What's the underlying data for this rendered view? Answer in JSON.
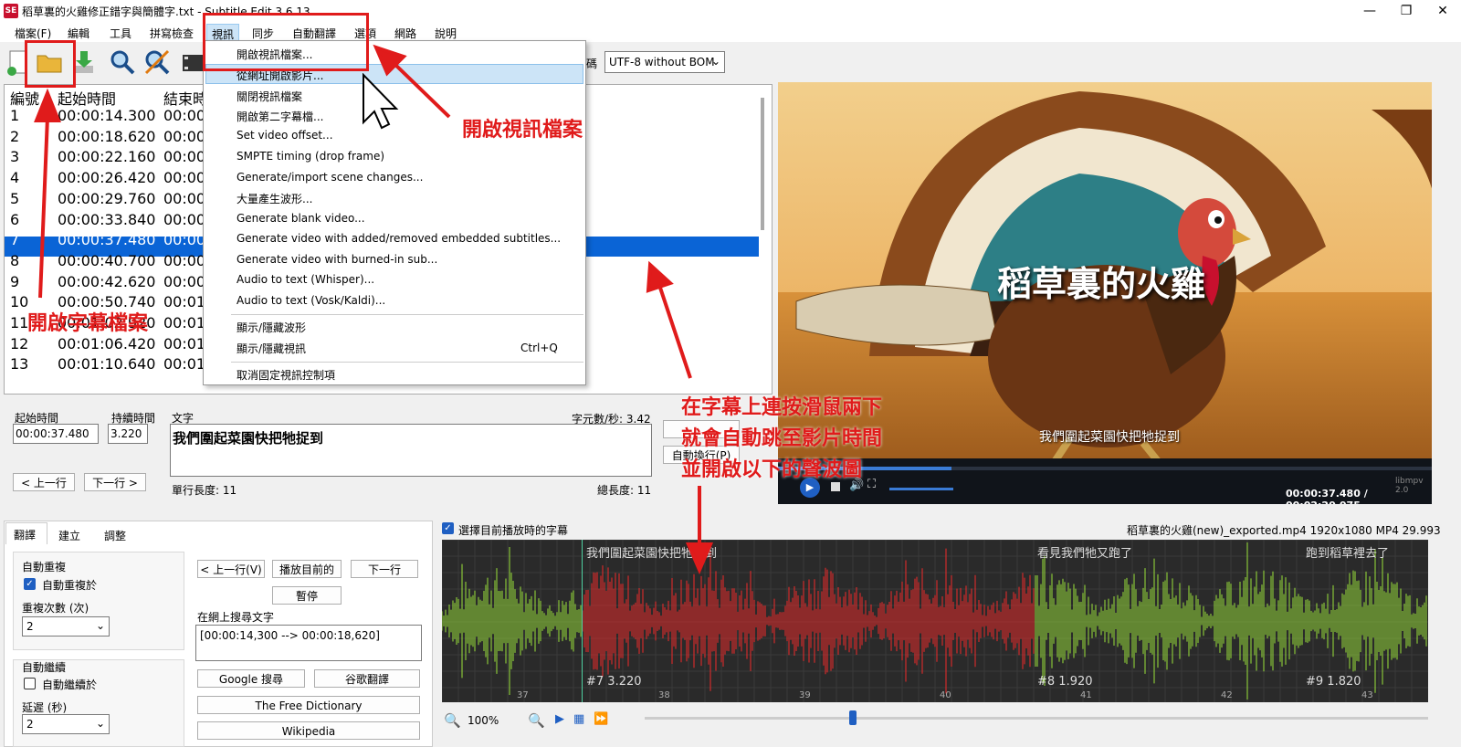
{
  "window": {
    "title": "稻草裏的火雞修正錯字與簡體字.txt - Subtitle Edit 3.6.13",
    "app_icon": "SE",
    "controls": [
      "—",
      "❐",
      "✕"
    ]
  },
  "menubar": [
    "檔案(F)",
    "編輯",
    "工具",
    "拼寫檢查",
    "視訊",
    "同步",
    "自動翻譯",
    "選項",
    "網路",
    "說明"
  ],
  "toolbar": {
    "encoding_label": "碼",
    "encoding_value": "UTF-8 without BOM"
  },
  "list": {
    "headers": [
      "編號",
      "起始時間",
      "結束時"
    ],
    "rows": [
      [
        "1",
        "00:00:14.300",
        "00:00"
      ],
      [
        "2",
        "00:00:18.620",
        "00:00"
      ],
      [
        "3",
        "00:00:22.160",
        "00:00"
      ],
      [
        "4",
        "00:00:26.420",
        "00:00"
      ],
      [
        "5",
        "00:00:29.760",
        "00:00"
      ],
      [
        "6",
        "00:00:33.840",
        "00:00"
      ],
      [
        "7",
        "00:00:37.480",
        "00:00"
      ],
      [
        "8",
        "00:00:40.700",
        "00:00"
      ],
      [
        "9",
        "00:00:42.620",
        "00:00"
      ],
      [
        "10",
        "00:00:50.740",
        "00:01"
      ],
      [
        "11",
        "00:01:02.920",
        "00:01"
      ],
      [
        "12",
        "00:01:06.420",
        "00:01"
      ],
      [
        "13",
        "00:01:10.640",
        "00:01"
      ]
    ],
    "selected_index": 6
  },
  "view_menu": {
    "items": [
      "開啟視訊檔案...",
      "從網址開啟影片...",
      "關閉視訊檔案",
      "開啟第二字幕檔...",
      "Set video offset...",
      "SMPTE timing (drop frame)",
      "Generate/import scene changes...",
      "大量產生波形...",
      "Generate blank video...",
      "Generate video with added/removed embedded subtitles...",
      "Generate video with burned-in sub...",
      "Audio to text (Whisper)...",
      "Audio to text (Vosk/Kaldi)...",
      "顯示/隱藏波形",
      "顯示/隱藏視訊",
      "取消固定視訊控制項"
    ],
    "shortcut": "Ctrl+Q",
    "highlighted": 1
  },
  "editor": {
    "start_label": "起始時間",
    "start_value": "00:00:37.480",
    "duration_label": "持續時間",
    "duration_value": "3.220",
    "text_label": "文字",
    "text_value": "我們圍起菜園快把牠捉到",
    "cps": "字元數/秒: 3.42",
    "line_length": "單行長度: 11",
    "total_length": "總長度: 11",
    "prev_button": "< 上一行",
    "next_button": "下一行 >",
    "auto_wrap": "自動換行(P)"
  },
  "video": {
    "title_overlay": "稻草裏的火雞",
    "subtitle": "我們圍起菜園快把牠捉到",
    "time": "00:00:37.480 / 00:02:20.075",
    "progress": 0.27,
    "player_logo": "libmpv 2.0"
  },
  "tabs": [
    "翻譯",
    "建立",
    "調整"
  ],
  "translate_panel": {
    "auto_repeat_title": "自動重複",
    "auto_repeat_on": "自動重複於",
    "repeat_count_label": "重複次數 (次)",
    "repeat_count": "2",
    "auto_continue_title": "自動繼續",
    "auto_continue_on": "自動繼續於",
    "delay_label": "延遲 (秒)",
    "delay": "2",
    "prev_line": "< 上一行(V)",
    "play_current": "播放目前的",
    "next_line": "下一行",
    "pause": "暫停",
    "search_label": "在網上搜尋文字",
    "search_value": "[00:00:14,300 --> 00:00:18,620]",
    "google_search": "Google 搜尋",
    "google_translate": "谷歌翻譯",
    "free_dictionary": "The Free Dictionary",
    "wikipedia": "Wikipedia"
  },
  "waveform": {
    "select_current": "選擇目前播放時的字幕",
    "file_info": "稻草裏的火雞(new)_exported.mp4 1920x1080 MP4 29.993",
    "segments": [
      {
        "text": "我們圍起菜園快把牠捉到",
        "label": "#7  3.220"
      },
      {
        "text": "看見我們牠又跑了",
        "label": "#8  1.920"
      },
      {
        "text": "跑到稻草裡去了",
        "label": "#9  1.820"
      }
    ],
    "ticks": [
      "37",
      "38",
      "39",
      "40",
      "41",
      "42",
      "43"
    ],
    "zoom": "100%"
  },
  "annotations": {
    "open_subtitle": "開啟字幕檔案",
    "open_video": "開啟視訊檔案",
    "hint_line1": "在字幕上連按滑鼠兩下",
    "hint_line2": "就會自動跳至影片時間",
    "hint_line3": "並開啟以下的聲波圖"
  },
  "colors": {
    "selection": "#0a64d6",
    "annotation": "#e01b1b",
    "wave_green": "#9be33a",
    "wave_red": "#f02a2a"
  }
}
